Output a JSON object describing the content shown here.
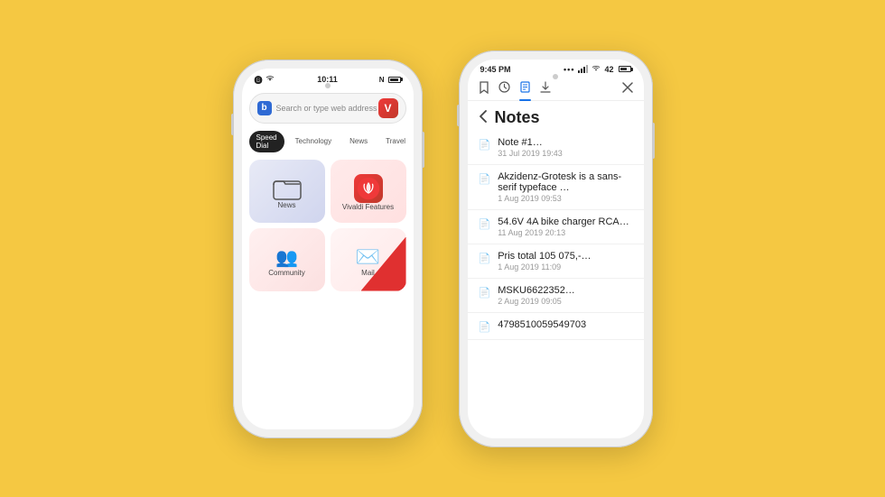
{
  "background": "#F5C842",
  "phone1": {
    "status": {
      "time": "10:11",
      "wifi": "wifi",
      "battery": "battery"
    },
    "search": {
      "placeholder": "Search or type web address"
    },
    "tabs": [
      {
        "label": "Speed Dial",
        "active": true
      },
      {
        "label": "Technology",
        "active": false
      },
      {
        "label": "News",
        "active": false
      },
      {
        "label": "Travel",
        "active": false
      }
    ],
    "dials": [
      {
        "label": "News",
        "type": "folder"
      },
      {
        "label": "Vivaldi Features",
        "type": "vivaldi"
      },
      {
        "label": "Community",
        "type": "community"
      },
      {
        "label": "Mail",
        "type": "mail"
      }
    ]
  },
  "phone2": {
    "status": {
      "time": "9:45 PM",
      "battery_level": "42"
    },
    "toolbar": {
      "bookmark_icon": "bookmark",
      "history_icon": "history",
      "notes_icon": "notes",
      "download_icon": "download",
      "close_icon": "close"
    },
    "notes": {
      "title": "Notes",
      "back_label": "back",
      "items": [
        {
          "title": "Note #1…",
          "date": "31 Jul 2019 19:43"
        },
        {
          "title": "Akzidenz-Grotesk is a sans-serif typeface …",
          "date": "1 Aug 2019 09:53"
        },
        {
          "title": "54.6V 4A bike charger RCA…",
          "date": "11 Aug 2019 20:13"
        },
        {
          "title": "Pris total 105 075,-…",
          "date": "1 Aug 2019 11:09"
        },
        {
          "title": "MSKU6622352…",
          "date": "2 Aug 2019 09:05"
        },
        {
          "title": "4798510059549703",
          "date": ""
        }
      ]
    }
  }
}
